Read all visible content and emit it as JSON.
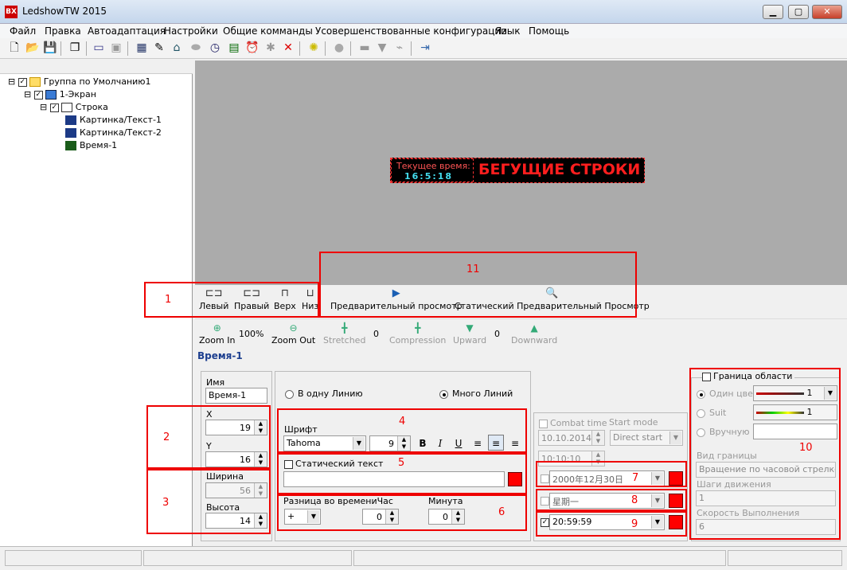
{
  "window": {
    "title": "LedshowTW 2015",
    "icon_text": "BX"
  },
  "menu": [
    "Файл",
    "Правка",
    "Автоадаптация",
    "Настройки",
    "Общие комманды",
    "Усовершенствованные конфигурации",
    "Язык",
    "Помощь"
  ],
  "tree": {
    "group": "Группа по Умолчанию1",
    "screen": "1-Экран",
    "row": "Строка",
    "items": [
      "Картинка/Текст-1",
      "Картинка/Текст-2",
      "Время-1"
    ]
  },
  "preview": {
    "led_current_label": "Текущее время:",
    "led_time": "16:5:18",
    "led_text": "БЕГУЩИЕ СТРОКИ",
    "led_colors": {
      "bg": "#000000",
      "text": "#ff1e1e",
      "time": "#44ddee"
    }
  },
  "align": {
    "left": "Левый",
    "right": "Правый",
    "top": "Верх",
    "bottom": "Низ"
  },
  "preview_buttons": {
    "preview": "Предварительный просмотр",
    "static_preview": "Статический Предварительный Просмотр"
  },
  "zoom": {
    "zoom_in": "Zoom In",
    "zoom_level": "100%",
    "zoom_out": "Zoom Out",
    "stretched": "Stretched",
    "stretched_value": "0",
    "compression": "Compression",
    "upward": "Upward",
    "upward_value": "0",
    "downward": "Downward"
  },
  "props": {
    "title": "Время-1",
    "name_label": "Имя",
    "name_value": "Время-1",
    "x_label": "X",
    "x_value": "19",
    "y_label": "Y",
    "y_value": "16",
    "width_label": "Ширина",
    "width_value": "56",
    "height_label": "Высота",
    "height_value": "14",
    "single_line": "В одну Линию",
    "multi_line": "Много Линий",
    "font_label": "Шрифт",
    "font_value": "Tahoma",
    "font_size": "9",
    "bold": "B",
    "italic": "I",
    "underline": "U",
    "static_text_label": "Статический текст",
    "time_diff_label": "Разница во времениЧас",
    "minute_label": "Минута",
    "sign_value": "+",
    "hour_value": "0",
    "minute_value": "0",
    "combat_time": "Combat time",
    "start_mode_label": "Start mode",
    "date_value": "10.10.2014",
    "start_mode_value": "Direct start",
    "time_value": "10:10:10",
    "date_format": "2000年12月30日",
    "week_format": "星期一",
    "time_format": "20:59:59",
    "border_label": "Граница области",
    "one_color": "Один цвет",
    "suit": "Suit",
    "manual": "Вручную",
    "line1_value": "1",
    "line2_value": "1",
    "border_type_label": "Вид границы",
    "border_type_value": "Вращение по часовой стрелке",
    "steps_label": "Шаги движения",
    "steps_value": "1",
    "speed_label": "Скорость Выполнения",
    "speed_value": "6"
  },
  "annotations": [
    "1",
    "2",
    "3",
    "4",
    "5",
    "6",
    "7",
    "8",
    "9",
    "10",
    "11"
  ],
  "colors": {
    "annotation": "#ee0000",
    "accent_red": "#ff0000",
    "title_blue": "#1d3f8f"
  }
}
